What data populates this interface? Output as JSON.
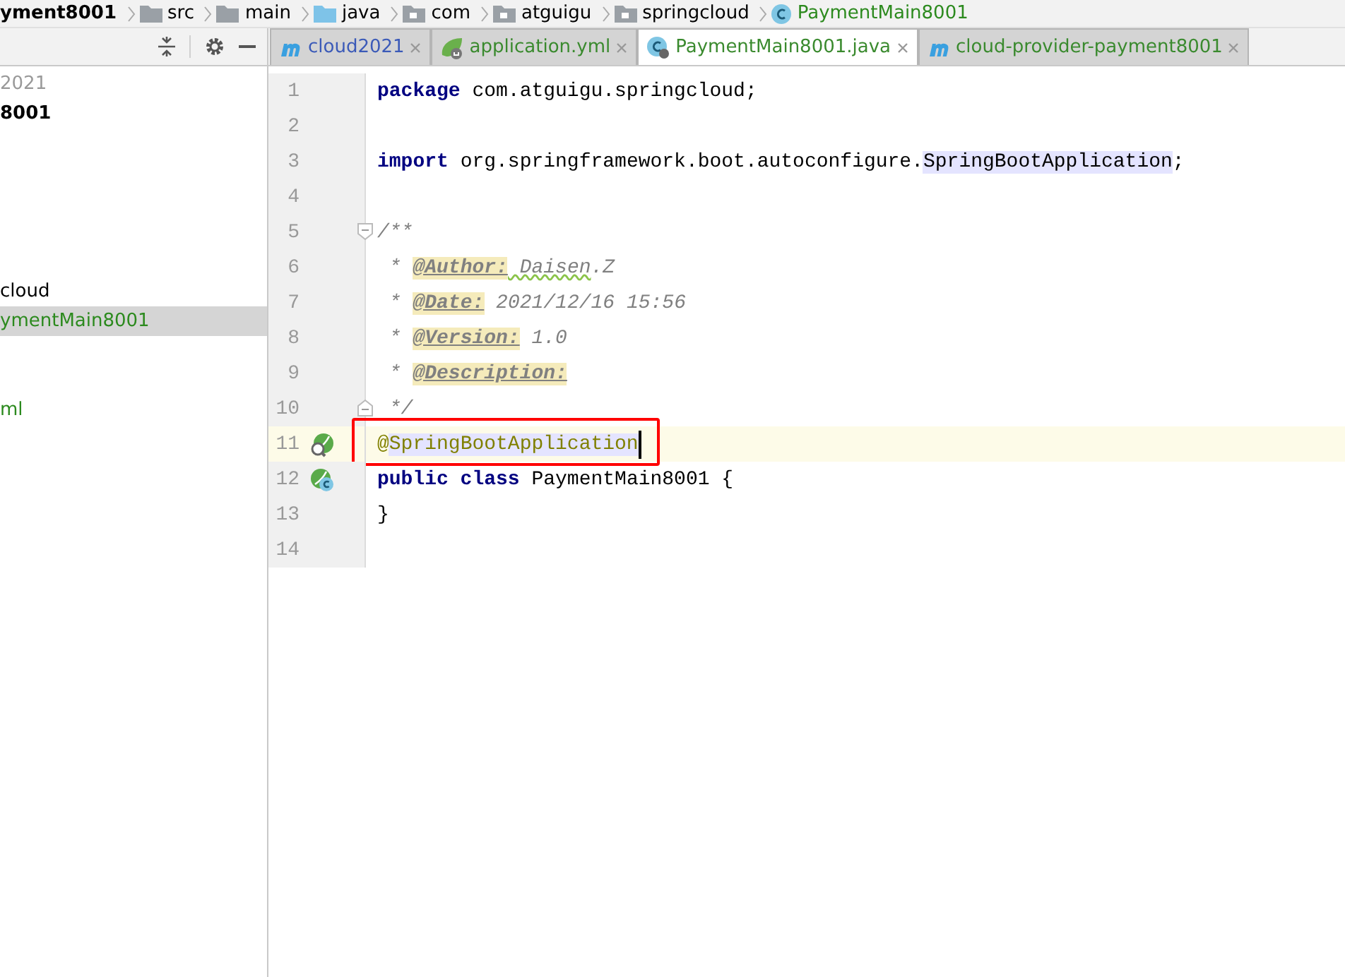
{
  "breadcrumbs": [
    {
      "label": "yment8001",
      "kind": "module"
    },
    {
      "label": "src",
      "kind": "folder"
    },
    {
      "label": "main",
      "kind": "folder"
    },
    {
      "label": "java",
      "kind": "source"
    },
    {
      "label": "com",
      "kind": "package"
    },
    {
      "label": "atguigu",
      "kind": "package"
    },
    {
      "label": "springcloud",
      "kind": "package"
    },
    {
      "label": "PaymentMain8001",
      "kind": "class"
    }
  ],
  "tabs": [
    {
      "label": "cloud2021",
      "kind": "maven",
      "color": "#3b5ab8",
      "selected": false
    },
    {
      "label": "application.yml",
      "kind": "spring",
      "color": "#3a8a2e",
      "selected": false
    },
    {
      "label": "PaymentMain8001.java",
      "kind": "class",
      "color": "#3a8a2e",
      "selected": true
    },
    {
      "label": "cloud-provider-payment8001",
      "kind": "maven",
      "color": "#3a8a2e",
      "selected": false
    }
  ],
  "project_tree": [
    {
      "label": "2021",
      "kind": "dim",
      "selected": false
    },
    {
      "label": "8001",
      "kind": "bold",
      "selected": false
    },
    {
      "label": "cloud",
      "kind": "plain",
      "selected": false
    },
    {
      "label": "ymentMain8001",
      "kind": "green",
      "selected": true
    },
    {
      "label": "ml",
      "kind": "green",
      "selected": false
    }
  ],
  "editor": {
    "lines": [
      {
        "number": "1",
        "current": false,
        "segments": [
          {
            "kind": "keyword",
            "text": "package"
          },
          {
            "kind": "plain",
            "text": " com.atguigu.springcloud;"
          }
        ]
      },
      {
        "number": "2",
        "current": false
      },
      {
        "number": "3",
        "current": false,
        "segments": [
          {
            "kind": "keyword",
            "text": "import"
          },
          {
            "kind": "plain",
            "text": " org.springframework.boot.autoconfigure."
          },
          {
            "kind": "marked",
            "text": "SpringBootApplication"
          },
          {
            "kind": "plain",
            "text": ";"
          }
        ]
      },
      {
        "number": "4",
        "current": false
      },
      {
        "number": "5",
        "current": false,
        "fold": {
          "kind": "open"
        },
        "segments": [
          {
            "kind": "doc",
            "text": "/**"
          }
        ]
      },
      {
        "number": "6",
        "current": false,
        "segments": [
          {
            "kind": "doc",
            "text": " * "
          },
          {
            "kind": "doctag",
            "text": "@Author:"
          },
          {
            "kind": "doc-typo",
            "text": " Daisen"
          },
          {
            "kind": "doc",
            "text": ".Z"
          }
        ]
      },
      {
        "number": "7",
        "current": false,
        "segments": [
          {
            "kind": "doc",
            "text": " * "
          },
          {
            "kind": "doctag",
            "text": "@Date:"
          },
          {
            "kind": "doc",
            "text": " 2021/12/16 15:56"
          }
        ]
      },
      {
        "number": "8",
        "current": false,
        "segments": [
          {
            "kind": "doc",
            "text": " * "
          },
          {
            "kind": "doctag",
            "text": "@Version:"
          },
          {
            "kind": "doc",
            "text": " 1.0"
          }
        ]
      },
      {
        "number": "9",
        "current": false,
        "segments": [
          {
            "kind": "doc",
            "text": " * "
          },
          {
            "kind": "doctag",
            "text": "@Description:"
          }
        ]
      },
      {
        "number": "10",
        "current": false,
        "fold": {
          "kind": "close"
        },
        "segments": [
          {
            "kind": "doc",
            "text": " */"
          }
        ]
      },
      {
        "number": "11",
        "current": true,
        "caret": true,
        "boxed": true,
        "gutter": {
          "kind": "bean-search"
        },
        "segments": [
          {
            "kind": "annotation",
            "text": "@"
          },
          {
            "kind": "annotation-marked",
            "text": "SpringBootApplication"
          }
        ]
      },
      {
        "number": "12",
        "current": false,
        "gutter": {
          "kind": "bean-class"
        },
        "segments": [
          {
            "kind": "keyword",
            "text": "public class"
          },
          {
            "kind": "plain",
            "text": " PaymentMain8001 {"
          }
        ]
      },
      {
        "number": "13",
        "current": false,
        "segments": [
          {
            "kind": "plain",
            "text": "}"
          }
        ]
      },
      {
        "number": "14",
        "current": false
      }
    ]
  }
}
